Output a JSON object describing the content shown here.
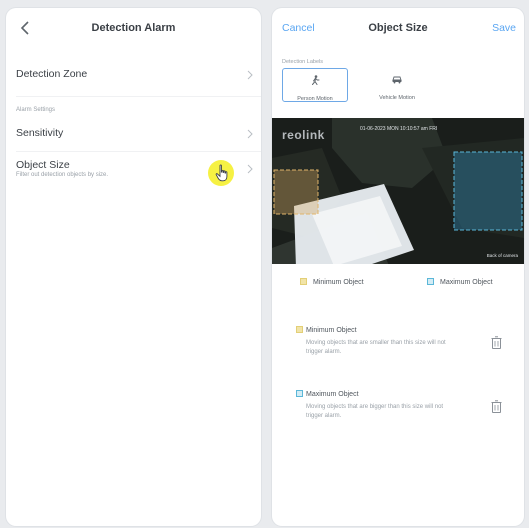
{
  "left": {
    "title": "Detection Alarm",
    "rows": {
      "detection_zone": "Detection Zone",
      "section_label": "Alarm Settings",
      "sensitivity": "Sensitivity",
      "object_size": "Object Size",
      "object_size_desc": "Filter out detection objects by size."
    }
  },
  "right": {
    "cancel": "Cancel",
    "title": "Object Size",
    "save": "Save",
    "detection_label": "Detection Labels",
    "types": [
      {
        "label": "Person Motion",
        "icon": "person-icon",
        "active": true
      },
      {
        "label": "Vehicle Motion",
        "icon": "car-icon",
        "active": false
      }
    ],
    "camera": {
      "logo": "reolink",
      "timestamp": "01-06-2023  MON  10:10:57 am  FRI",
      "name": "Back of camera"
    },
    "legend": {
      "min": "Minimum Object",
      "max": "Maximum Object"
    },
    "objects": [
      {
        "title": "Minimum Object",
        "desc": "Moving objects that are smaller than this size will not trigger alarm."
      },
      {
        "title": "Maximum Object",
        "desc": "Moving objects that are bigger than this size will not trigger alarm."
      }
    ]
  },
  "colors": {
    "accent": "#5aa6f2",
    "min_object": "#e3cf77",
    "max_object": "#5bb7d8",
    "cursor_highlight": "#f5f02f"
  }
}
